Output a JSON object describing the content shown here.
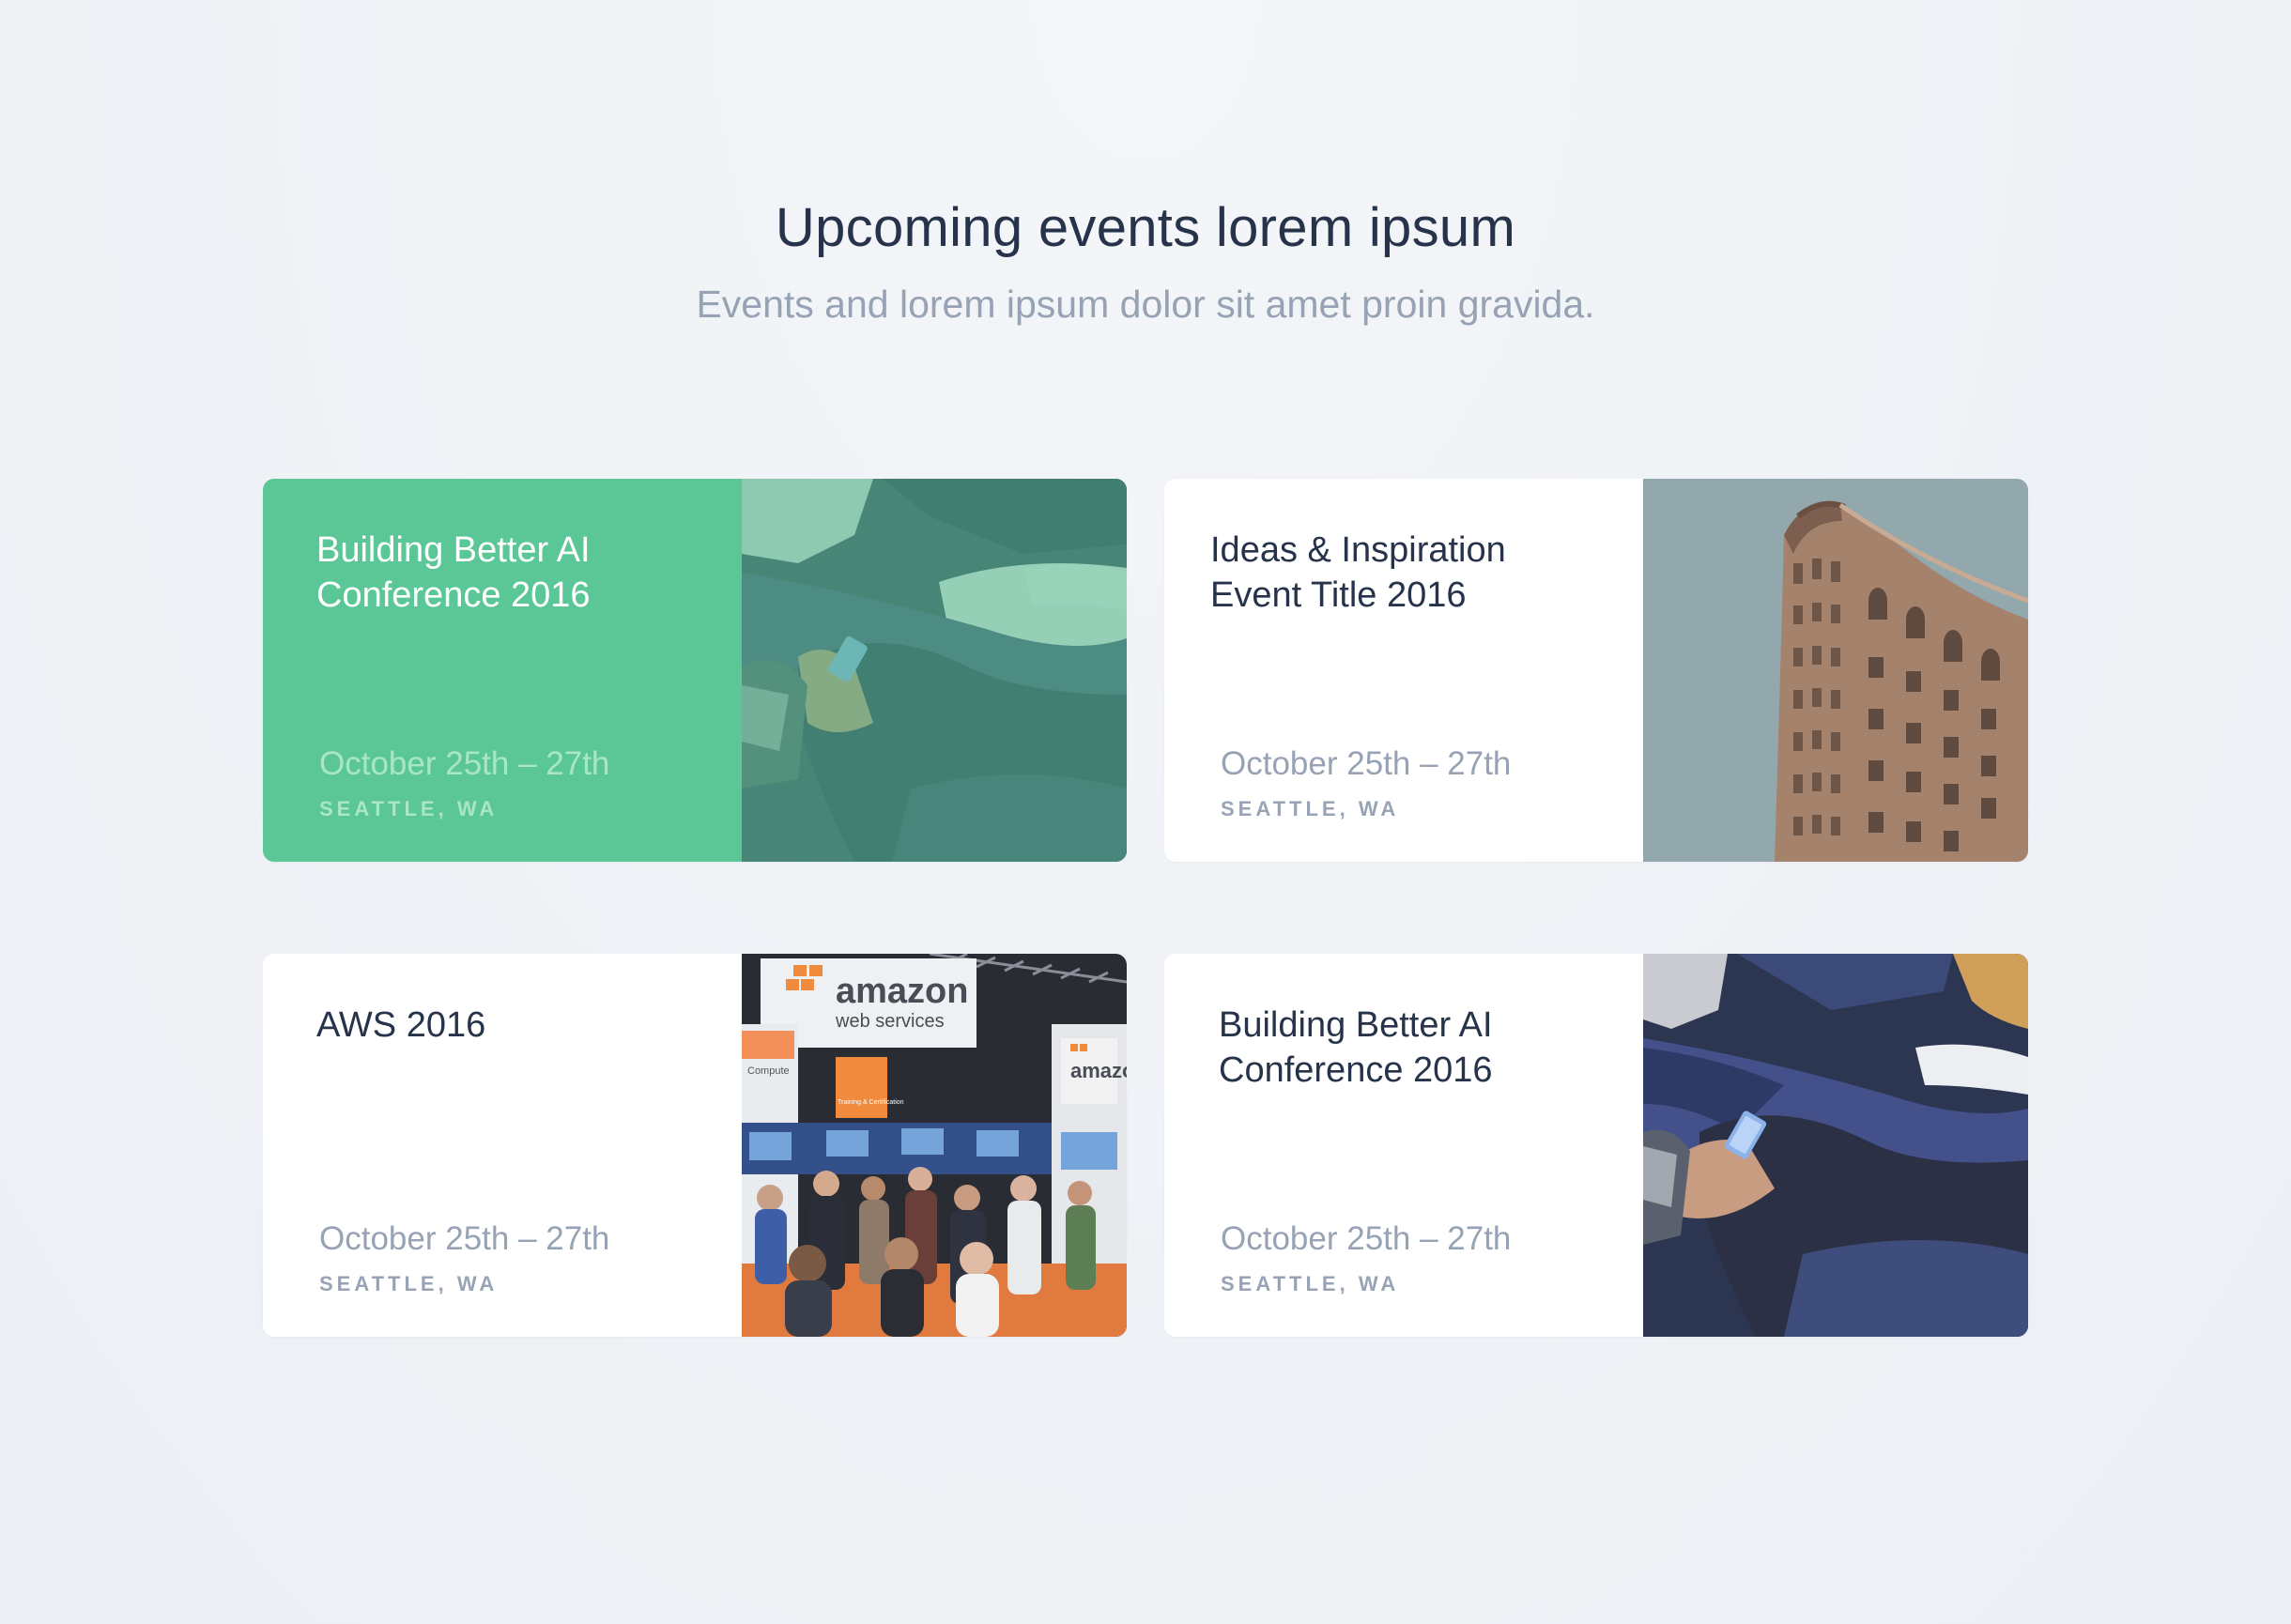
{
  "header": {
    "title": "Upcoming events lorem ipsum",
    "subtitle": "Events and lorem ipsum dolor sit amet proin gravida."
  },
  "colors": {
    "accent": "#5bc797",
    "heading": "#26334a",
    "muted": "#97a3b5",
    "background": "#eef1f5",
    "card": "#ffffff"
  },
  "events": [
    {
      "title": "Building Better AI Conference 2016",
      "date": "October 25th – 27th",
      "location": "SEATTLE, WA",
      "featured": true,
      "image": "crowd-phone-photo"
    },
    {
      "title": "Ideas & Inspiration Event Title 2016",
      "date": "October 25th – 27th",
      "location": "SEATTLE, WA",
      "featured": false,
      "image": "building-photo"
    },
    {
      "title": "AWS 2016",
      "date": "October 25th – 27th",
      "location": "SEATTLE, WA",
      "featured": false,
      "image": "expo-hall-photo",
      "image_text": {
        "brand": "amazon",
        "brand_sub": "web services",
        "booth_label": "Compute",
        "booth_label_2": "Training & Certification"
      }
    },
    {
      "title": "Building Better AI Conference 2016",
      "date": "October 25th – 27th",
      "location": "SEATTLE, WA",
      "featured": false,
      "image": "crowd-phone-photo"
    }
  ]
}
